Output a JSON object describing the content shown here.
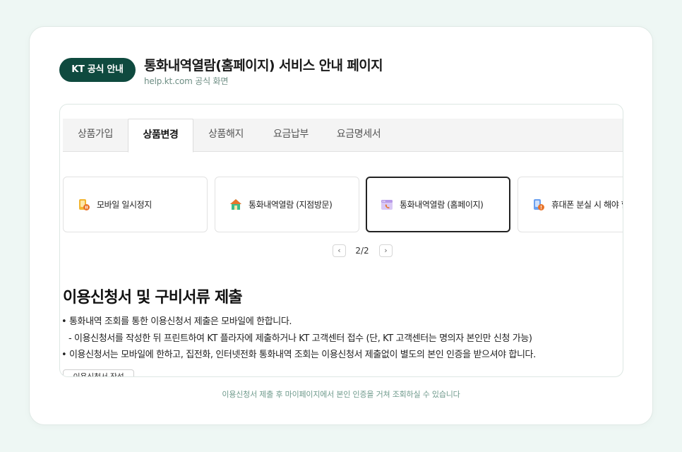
{
  "header": {
    "badge": "KT 공식 안내",
    "title": "통화내역열람(홈페이지) 서비스 안내 페이지",
    "subtitle": "help.kt.com 공식 화면"
  },
  "tabs": [
    {
      "label": "상품가입"
    },
    {
      "label": "상품변경"
    },
    {
      "label": "상품해지"
    },
    {
      "label": "요금납부"
    },
    {
      "label": "요금명세서"
    }
  ],
  "active_tab": "상품변경",
  "services": [
    {
      "label": "모바일 일시정지",
      "icon": "mobile-pause-icon"
    },
    {
      "label": "통화내역열람 (지점방문)",
      "icon": "house-icon"
    },
    {
      "label": "통화내역열람 (홈페이지)",
      "icon": "browser-call-icon"
    },
    {
      "label": "휴대폰 분실 시 해야 할",
      "icon": "phone-lost-icon"
    }
  ],
  "pager": {
    "prev": "‹",
    "next": "›",
    "current": "2/2"
  },
  "content": {
    "section_title": "이용신청서 및 구비서류 제출",
    "bullets": [
      "• 통화내역 조회를 통한 이용신청서 제출은 모바일에 한합니다.",
      "- 이용신청서를 작성한 뒤 프린트하여 KT 플라자에 제출하거나 KT 고객센터 접수 (단, KT 고객센터는 명의자 본인만 신청 가능)",
      "• 이용신청서는 모바일에 한하고, 집전화, 인터넷전화 통화내역 조회는 이용신청서 제출없이 별도의 본인 인증을 받으셔야 합니다."
    ],
    "button": "이용신청서 작성"
  },
  "caption": "이용신청서 제출 후 마이페이지에서 본인 인증을 거쳐 조회하실 수 있습니다",
  "colors": {
    "brand": "#0f4a3f",
    "background": "#eef7f4",
    "caption": "#6f9a8c"
  }
}
